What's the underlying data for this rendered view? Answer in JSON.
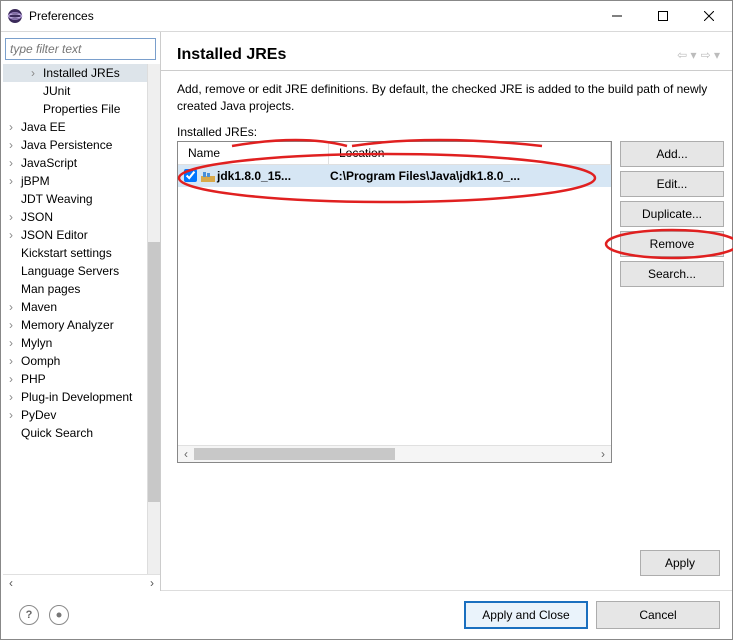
{
  "window": {
    "title": "Preferences"
  },
  "filter": {
    "placeholder": "type filter text"
  },
  "tree": [
    {
      "label": "Installed JREs",
      "level": 2,
      "expander": "›",
      "selected": true
    },
    {
      "label": "JUnit",
      "level": 2,
      "expander": ""
    },
    {
      "label": "Properties File",
      "level": 2,
      "expander": ""
    },
    {
      "label": "Java EE",
      "level": 1,
      "expander": "›"
    },
    {
      "label": "Java Persistence",
      "level": 1,
      "expander": "›"
    },
    {
      "label": "JavaScript",
      "level": 1,
      "expander": "›"
    },
    {
      "label": "jBPM",
      "level": 1,
      "expander": "›"
    },
    {
      "label": "JDT Weaving",
      "level": 1,
      "expander": ""
    },
    {
      "label": "JSON",
      "level": 1,
      "expander": "›"
    },
    {
      "label": "JSON Editor",
      "level": 1,
      "expander": "›"
    },
    {
      "label": "Kickstart settings",
      "level": 1,
      "expander": ""
    },
    {
      "label": "Language Servers",
      "level": 1,
      "expander": ""
    },
    {
      "label": "Man pages",
      "level": 1,
      "expander": ""
    },
    {
      "label": "Maven",
      "level": 1,
      "expander": "›"
    },
    {
      "label": "Memory Analyzer",
      "level": 1,
      "expander": "›"
    },
    {
      "label": "Mylyn",
      "level": 1,
      "expander": "›"
    },
    {
      "label": "Oomph",
      "level": 1,
      "expander": "›"
    },
    {
      "label": "PHP",
      "level": 1,
      "expander": "›"
    },
    {
      "label": "Plug-in Development",
      "level": 1,
      "expander": "›"
    },
    {
      "label": "PyDev",
      "level": 1,
      "expander": "›"
    },
    {
      "label": "Quick Search",
      "level": 1,
      "expander": ""
    }
  ],
  "page": {
    "heading": "Installed JREs",
    "description": "Add, remove or edit JRE definitions. By default, the checked JRE is added to the build path of newly created Java projects.",
    "list_label": "Installed JREs:"
  },
  "table": {
    "cols": {
      "name": "Name",
      "location": "Location"
    },
    "rows": [
      {
        "checked": true,
        "name": "jdk1.8.0_15...",
        "location": "C:\\Program Files\\Java\\jdk1.8.0_..."
      }
    ]
  },
  "buttons": {
    "add": "Add...",
    "edit": "Edit...",
    "duplicate": "Duplicate...",
    "remove": "Remove",
    "search": "Search...",
    "apply": "Apply",
    "apply_close": "Apply and Close",
    "cancel": "Cancel"
  }
}
